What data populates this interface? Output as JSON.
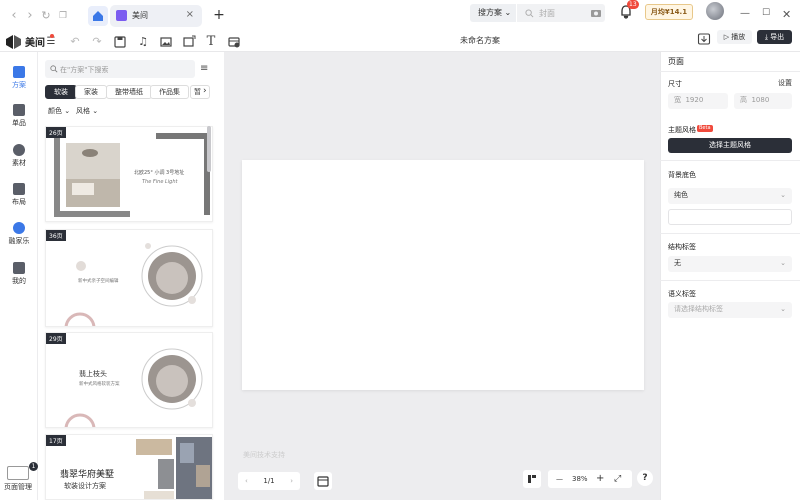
{
  "tab": {
    "title": "美间"
  },
  "search": {
    "scope": "搜方案",
    "placeholder": "封面"
  },
  "notifications": {
    "count": "13"
  },
  "vip": {
    "label": "月均¥14.1"
  },
  "toolbar": {
    "logo": "美间",
    "doc_title": "未命名方案",
    "play": "播放",
    "export": "导出"
  },
  "leftnav": {
    "items": [
      {
        "label": "方案",
        "icon": "scheme-icon"
      },
      {
        "label": "单品",
        "icon": "product-icon"
      },
      {
        "label": "素材",
        "icon": "material-icon"
      },
      {
        "label": "布局",
        "icon": "layout-icon"
      },
      {
        "label": "融家乐",
        "icon": "home-icon"
      },
      {
        "label": "我的",
        "icon": "user-icon"
      }
    ],
    "page_manage": "页面管理",
    "page_count": "1"
  },
  "panel": {
    "search_placeholder": "在\"方案\"下搜索",
    "chips": [
      "软装",
      "家装",
      "整带墙纸",
      "作品集",
      "暂"
    ],
    "filters": {
      "color": "颜色",
      "style": "风格"
    },
    "cards": [
      {
        "pages": "26页",
        "text1": "北欧25°  小调  3号地址",
        "text2": "The Fine Light"
      },
      {
        "pages": "36页",
        "text1": "新中式亲子空间编辑"
      },
      {
        "pages": "29页",
        "text1": "翡上枝头",
        "text2": "新中式风格软装方案"
      },
      {
        "pages": "17页",
        "text1": "翡翠华府美墅",
        "text2": "软装设计方案"
      }
    ]
  },
  "canvas": {
    "pager": "1/1",
    "watermark": "美间技术支持",
    "zoom": "38%"
  },
  "rpanel": {
    "title": "页面",
    "size_label": "尺寸",
    "settings": "设置",
    "width_label": "宽",
    "width": "1920",
    "height_label": "高",
    "height": "1080",
    "theme_label": "主题风格",
    "beta": "Beta",
    "theme_button": "选择主题风格",
    "bg_label": "背景底色",
    "bg_value": "纯色",
    "struct_label": "结构标签",
    "struct_value": "无",
    "semantic_label": "语义标签",
    "semantic_placeholder": "请选择结构标签"
  }
}
